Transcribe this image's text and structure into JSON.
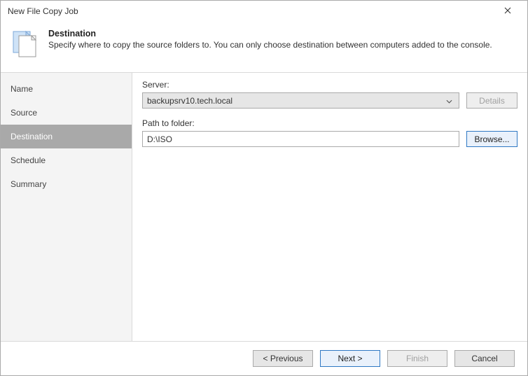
{
  "window": {
    "title": "New File Copy Job"
  },
  "header": {
    "title": "Destination",
    "subtitle": "Specify where to copy the source folders to. You can only choose destination between computers added to the console."
  },
  "sidebar": {
    "steps": {
      "name": "Name",
      "source": "Source",
      "destination": "Destination",
      "schedule": "Schedule",
      "summary": "Summary"
    }
  },
  "form": {
    "server_label": "Server:",
    "server_value": "backupsrv10.tech.local",
    "details_label": "Details",
    "path_label": "Path to folder:",
    "path_value": "D:\\ISO",
    "browse_label": "Browse..."
  },
  "footer": {
    "previous": "< Previous",
    "next": "Next >",
    "finish": "Finish",
    "cancel": "Cancel"
  }
}
